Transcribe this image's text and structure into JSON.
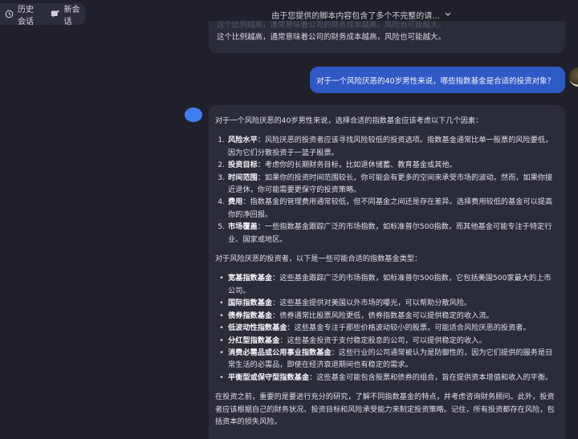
{
  "top_chip": {
    "history_label": "历史会话",
    "new_label": "新会话"
  },
  "header": {
    "title": "由于您提供的脚本内容包含了多个不完整的请..."
  },
  "prev_card": {
    "ghost_text": "这个比例越高，通常意味着公司的财务成本越高，风险也可能越大。",
    "text": "这个比例越高，通常意味着公司的财务成本越高，风险也可能越大。"
  },
  "user_message": "对于一个风险厌恶的40岁男性来说，哪些指数基金是合适的投资对象？",
  "answer": {
    "intro": "对于一个风险厌恶的40岁男性来说，选择合适的指数基金应该考虑以下几个因素：",
    "factors": [
      {
        "num": "1.",
        "title": "风险水平",
        "body": "：风险厌恶的投资者应该寻找风险较低的投资选项。指数基金通常比单一股票的风险要低，因为它们分散投资于一篮子股票。"
      },
      {
        "num": "2.",
        "title": "投资目标",
        "body": "：考虑你的长期财务目标，比如退休储蓄、教育基金或其他。"
      },
      {
        "num": "3.",
        "title": "时间范围",
        "body": "：如果你的投资时间范围较长，你可能会有更多的空间来承受市场的波动。然而，如果你接近退休，你可能需要更保守的投资策略。"
      },
      {
        "num": "4.",
        "title": "费用",
        "body": "：指数基金的管理费用通常较低，但不同基金之间还是存在差异。选择费用较低的基金可以提高你的净回报。"
      },
      {
        "num": "5.",
        "title": "市场覆盖",
        "body": "：一些指数基金跟踪广泛的市场指数，如标准普尔500指数，而其他基金可能专注于特定行业、国家或地区。"
      }
    ],
    "types_intro": "对于风险厌恶的投资者，以下是一些可能合适的指数基金类型：",
    "types": [
      {
        "title": "宽基指数基金",
        "body": "：这些基金跟踪广泛的市场指数，如标准普尔500指数，它包括美国500家最大的上市公司。"
      },
      {
        "title": "国际指数基金",
        "body": "：这些基金提供对美国以外市场的曝光，可以帮助分散风险。"
      },
      {
        "title": "债券指数基金",
        "body": "：债券通常比股票风险更低，债券指数基金可以提供稳定的收入流。"
      },
      {
        "title": "低波动性指数基金",
        "body": "：这些基金专注于那些价格波动较小的股票，可能适合风险厌恶的投资者。"
      },
      {
        "title": "分红型指数基金",
        "body": "：这些基金投资于支付稳定股息的公司，可以提供稳定的收入。"
      },
      {
        "title": "消费必需品或公用事业指数基金",
        "body": "：这些行业的公司通常被认为是防御性的，因为它们提供的服务是日常生活的必需品，即使在经济衰退期间也有稳定的需求。"
      },
      {
        "title": "平衡型或保守型指数基金",
        "body": "：这些基金可能包含股票和债券的组合，旨在提供资本增值和收入的平衡。"
      }
    ],
    "conclusion": "在投资之前，重要的是要进行充分的研究，了解不同指数基金的特点，并考虑咨询财务顾问。此外，投资者应该根据自己的财务状况、投资目标和风险承受能力来制定投资策略。记住，所有投资都存在风险，包括资本的损失风险。"
  }
}
